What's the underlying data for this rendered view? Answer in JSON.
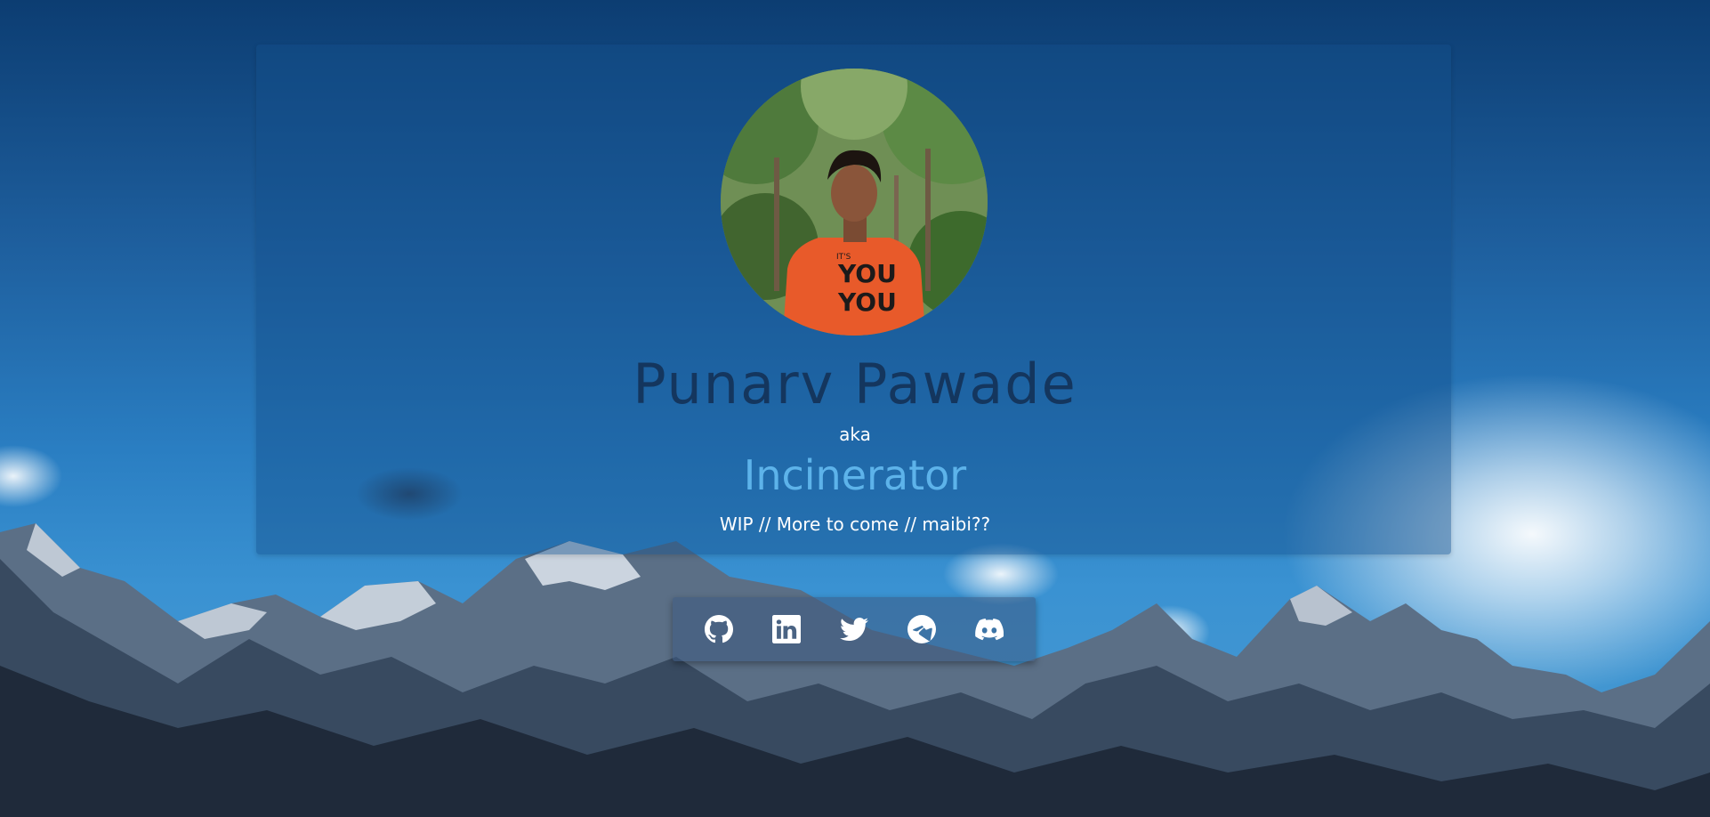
{
  "profile": {
    "name": "Punarv Pawade",
    "aka": "aka",
    "alias": "Incinerator",
    "tagline": "WIP // More to come // maibi??",
    "shirt_text_small": "IT'S",
    "shirt_text_line1": "YOU",
    "shirt_text_line2": "YOU"
  },
  "social": [
    {
      "name": "github",
      "icon": "github-icon"
    },
    {
      "name": "linkedin",
      "icon": "linkedin-icon"
    },
    {
      "name": "twitter",
      "icon": "twitter-icon"
    },
    {
      "name": "telegram",
      "icon": "telegram-icon"
    },
    {
      "name": "discord",
      "icon": "discord-icon"
    }
  ],
  "colors": {
    "name": "#14365e",
    "alias": "#5db3ea",
    "card": "rgba(20, 80, 140, 0.45)",
    "shirt": "#e85a2a"
  }
}
